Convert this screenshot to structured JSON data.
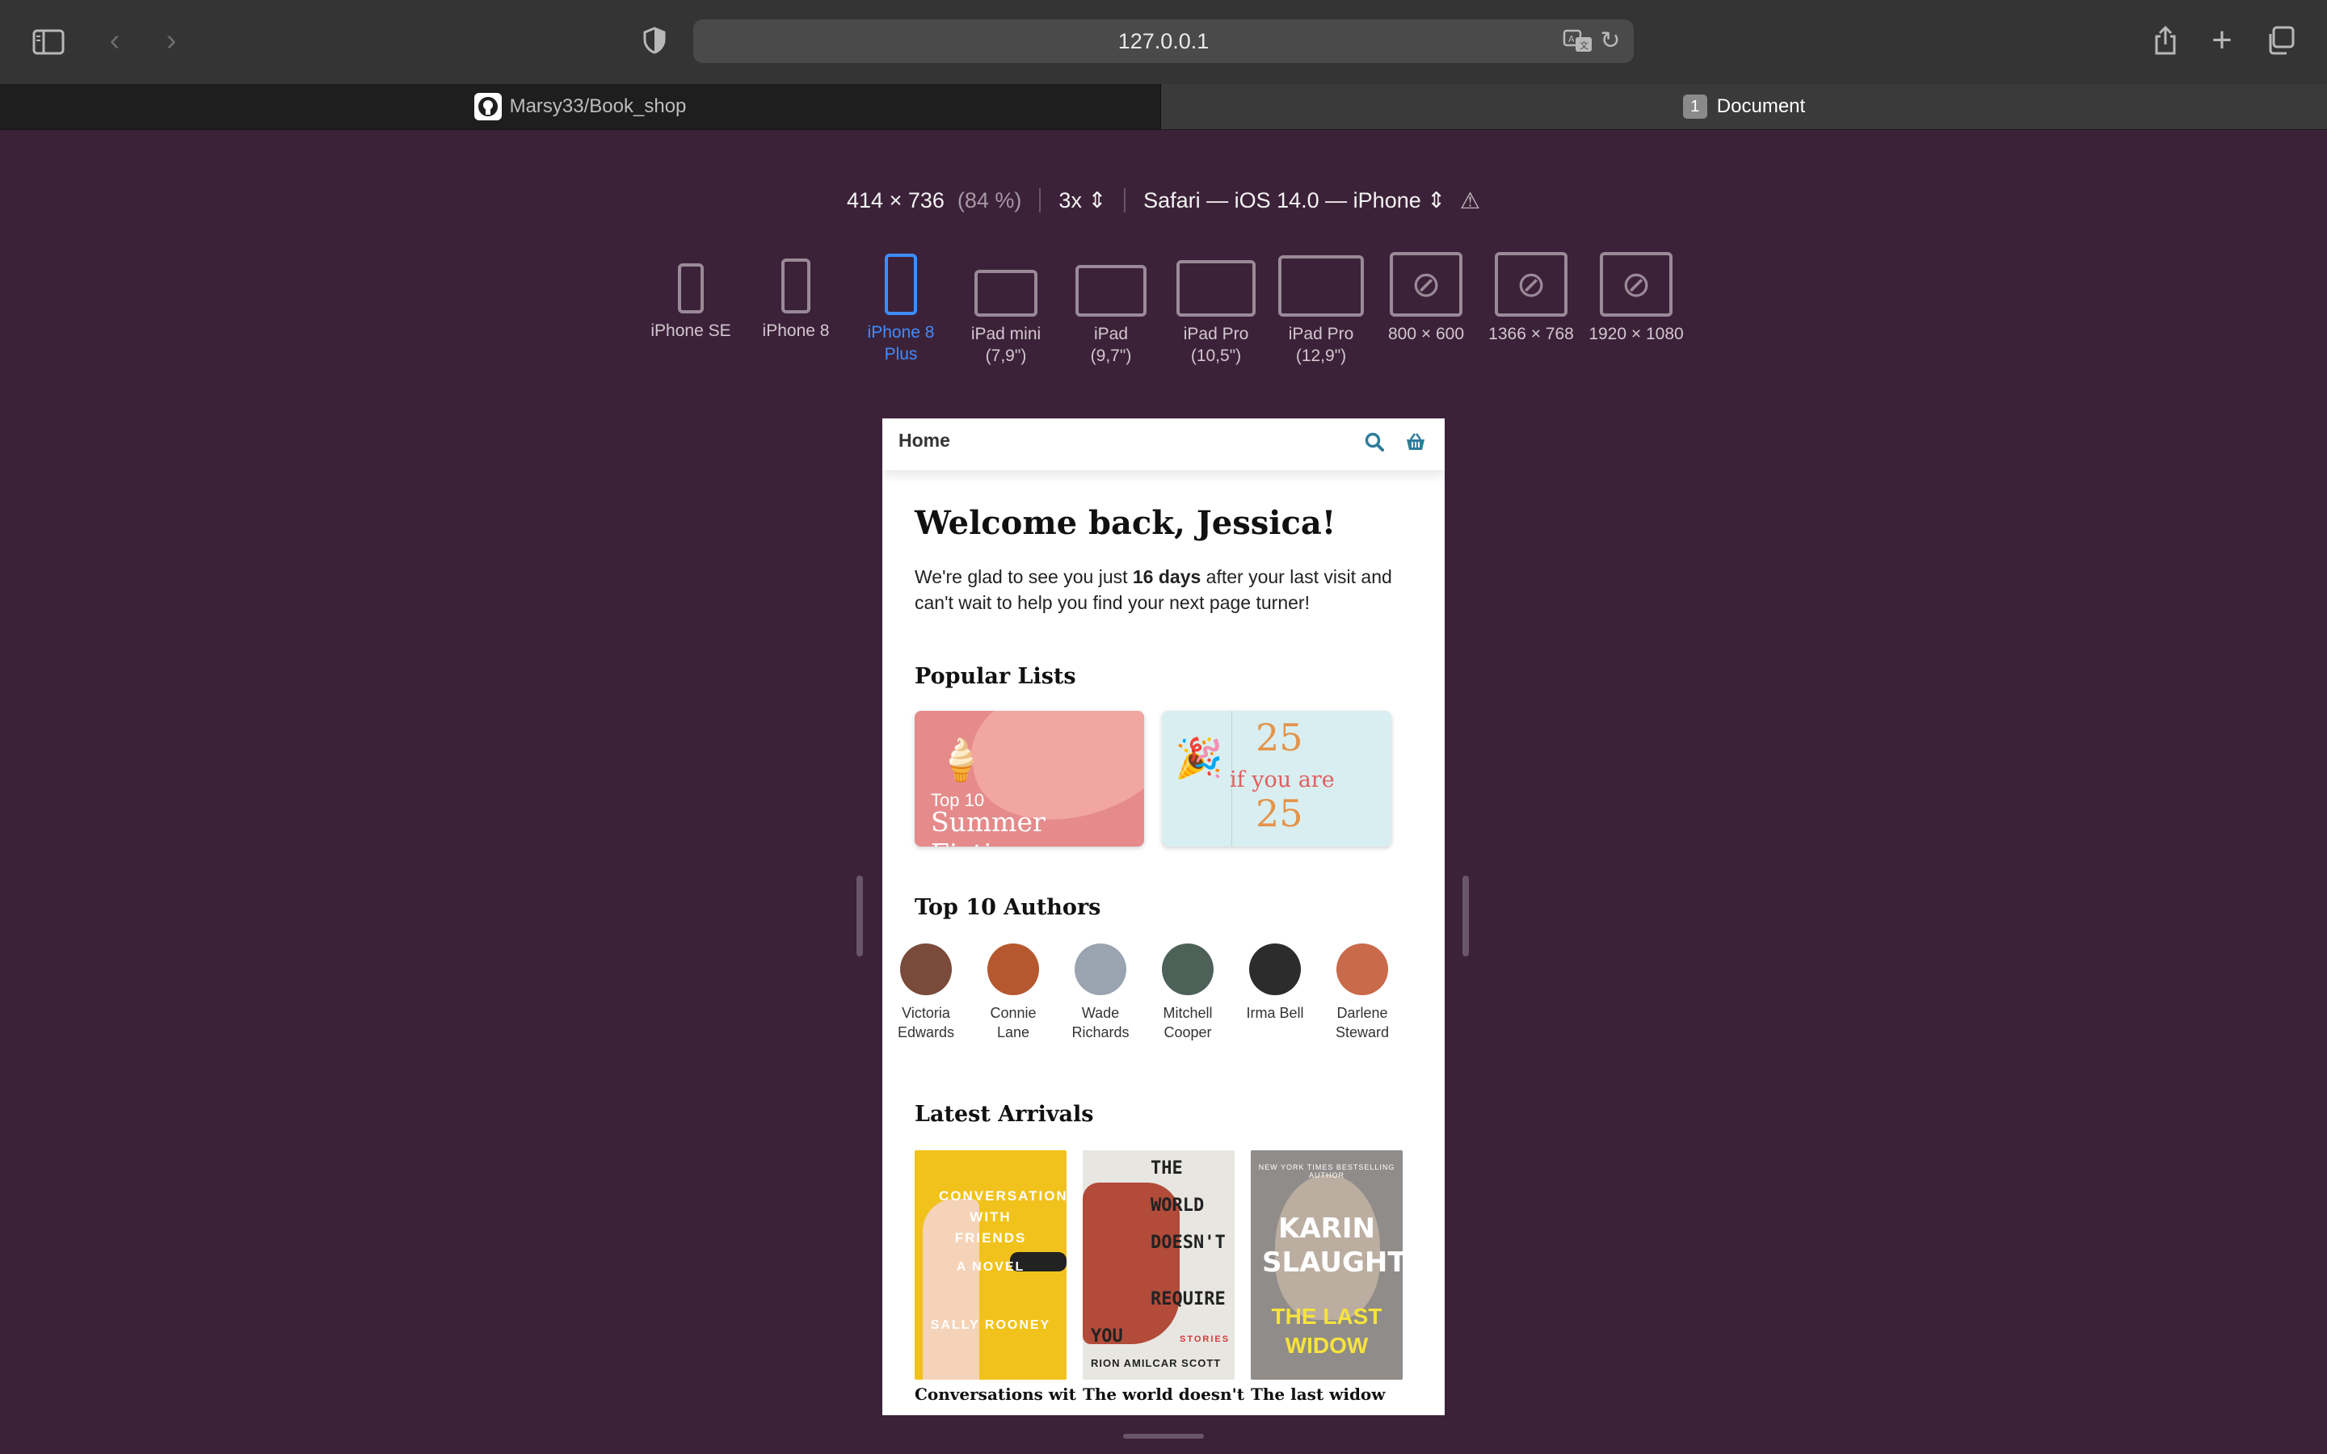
{
  "browser": {
    "url": "127.0.0.1",
    "tabs": [
      {
        "label": "Marsy33/Book_shop"
      },
      {
        "badge": "1",
        "label": "Document"
      }
    ]
  },
  "responsive": {
    "dimensions": "414 × 736",
    "zoom": "(84 %)",
    "scale": "3x",
    "user_agent": "Safari — iOS 14.0 — iPhone",
    "devices": [
      {
        "label": "iPhone SE"
      },
      {
        "label": "iPhone 8"
      },
      {
        "label": "iPhone 8 Plus",
        "active": true
      },
      {
        "label": "iPad mini (7,9\")"
      },
      {
        "label": "iPad (9,7\")"
      },
      {
        "label": "iPad Pro (10,5\")"
      },
      {
        "label": "iPad Pro (12,9\")"
      },
      {
        "label": "800 × 600"
      },
      {
        "label": "1366 × 768"
      },
      {
        "label": "1920 × 1080"
      }
    ]
  },
  "app": {
    "header_title": "Home",
    "welcome": "Welcome back, Jessica!",
    "intro_before": "We're glad to see you just ",
    "intro_bold": "16 days",
    "intro_after": " after your last visit and can't wait to help you find your next page turner!",
    "popular_title": "Popular Lists",
    "list1": {
      "small": "Top 10",
      "big": "Summer Fiction"
    },
    "list2": {
      "top": "25",
      "middle": "if you are",
      "bottom": "25"
    },
    "authors_title": "Top 10 Authors",
    "authors": [
      {
        "first": "Victoria",
        "last": "Edwards",
        "color": "#7a4a3a"
      },
      {
        "first": "Connie",
        "last": "Lane",
        "color": "#b5582f"
      },
      {
        "first": "Wade",
        "last": "Richards",
        "color": "#9aa4b0"
      },
      {
        "first": "Mitchell",
        "last": "Cooper",
        "color": "#4d6158"
      },
      {
        "first": "Irma Bell",
        "last": "",
        "color": "#2c2c2c"
      },
      {
        "first": "Darlene",
        "last": "Steward",
        "color": "#c96a4a"
      }
    ],
    "arrivals_title": "Latest Arrivals",
    "books": [
      {
        "title": "Conversations with",
        "cover_title": "CONVERSATIONS WITH FRIENDS",
        "cover_sub": "A NOVEL",
        "cover_author": "SALLY ROONEY"
      },
      {
        "title": "The world doesn't",
        "cover_lines": [
          "THE",
          "WORLD",
          "DOESN'T",
          "REQUIRE",
          "YOU"
        ],
        "cover_sub": "STORIES",
        "cover_author": "RION AMILCAR SCOTT"
      },
      {
        "title": "The last widow",
        "cover_tag": "NEW YORK TIMES BESTSELLING AUTHOR",
        "cover_author": "KARIN SLAUGHTER",
        "cover_title": "THE LAST WIDOW"
      }
    ]
  }
}
